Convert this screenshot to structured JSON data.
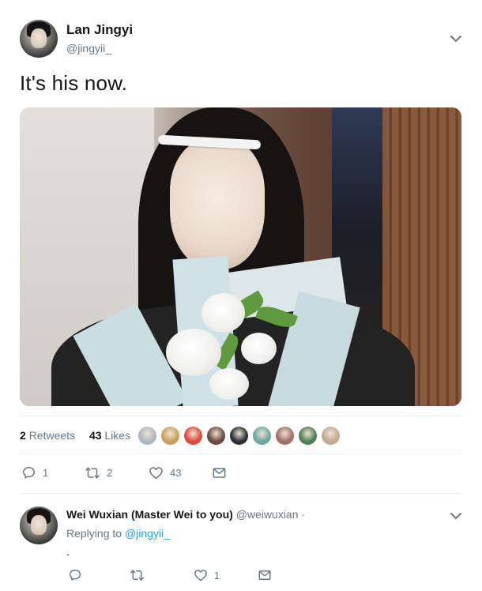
{
  "tweet": {
    "author_name": "Lan Jingyi",
    "author_handle": "@jingyii_",
    "text": "It's his now.",
    "menu_icon": "chevron-down-icon",
    "retweets_count": "2",
    "retweets_label": "Retweets",
    "likes_count": "43",
    "likes_label": "Likes",
    "liker_colors": [
      "#aab8c2",
      "#c9a15c",
      "#e0483e",
      "#6b4a3f",
      "#2b2f37",
      "#6ba7a0",
      "#a0706a",
      "#4f7f54",
      "#c4a993"
    ],
    "actions": {
      "reply_count": "1",
      "retweet_count": "2",
      "like_count": "43",
      "dm_icon": "envelope-icon"
    }
  },
  "reply": {
    "author_name": "Wei Wuxian (Master Wei to you)",
    "author_handle": "@weiwuxian",
    "separator": "·",
    "replying_prefix": "Replying to",
    "replying_to": "@jingyii_",
    "text": ".",
    "menu_icon": "chevron-down-icon",
    "actions": {
      "reply_count": "",
      "retweet_count": "",
      "like_count": "1",
      "dm_icon": "envelope-icon"
    }
  },
  "colors": {
    "text_primary": "#14171a",
    "text_secondary": "#657786",
    "link": "#1da1f2",
    "divider": "#e6ecf0"
  }
}
